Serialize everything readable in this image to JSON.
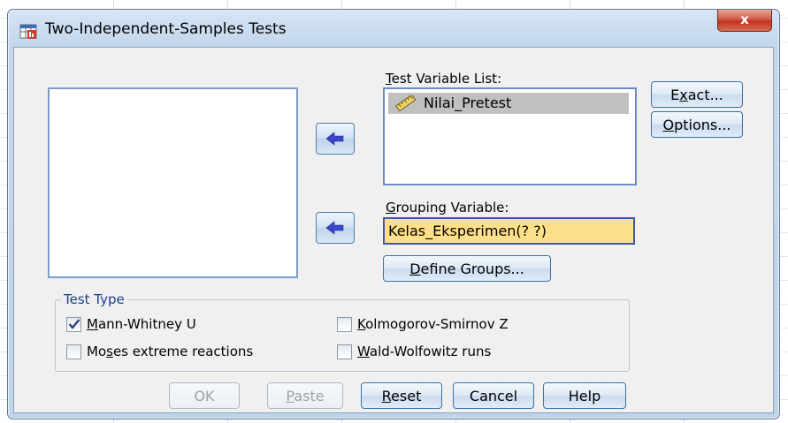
{
  "window": {
    "title": "Two-Independent-Samples Tests",
    "close_glyph": "x"
  },
  "source_list": {
    "items": []
  },
  "test_variable": {
    "label_accel": "T",
    "label_rest": "est Variable List:",
    "items": [
      {
        "name": "Nilai_Pretest",
        "icon": "scale-ruler-icon"
      }
    ]
  },
  "grouping_variable": {
    "label_accel": "G",
    "label_rest": "rouping Variable:",
    "value": "Kelas_Eksperimen(? ?)"
  },
  "buttons": {
    "define_groups": {
      "accel": "D",
      "rest": "efine Groups..."
    },
    "exact": {
      "pre": "E",
      "accel": "x",
      "rest": "act..."
    },
    "options": {
      "accel": "O",
      "rest": "ptions..."
    },
    "ok": "OK",
    "paste": {
      "accel": "P",
      "rest": "aste"
    },
    "reset": {
      "accel": "R",
      "rest": "eset"
    },
    "cancel": "Cancel",
    "help": "Help"
  },
  "test_type": {
    "title": "Test Type",
    "options": [
      {
        "pre": "",
        "accel": "M",
        "rest": "ann-Whitney U",
        "checked": true
      },
      {
        "pre": "",
        "accel": "K",
        "rest": "olmogorov-Smirnov Z",
        "checked": false
      },
      {
        "pre": "Mo",
        "accel": "s",
        "rest": "es extreme reactions",
        "checked": false
      },
      {
        "pre": "",
        "accel": "W",
        "rest": "ald-Wolfowitz runs",
        "checked": false
      }
    ]
  },
  "colors": {
    "highlight_field": "#ffe08a",
    "selected_item": "#c0c0c0",
    "group_title": "#1d3f8f",
    "close_button": "#c0331c"
  }
}
